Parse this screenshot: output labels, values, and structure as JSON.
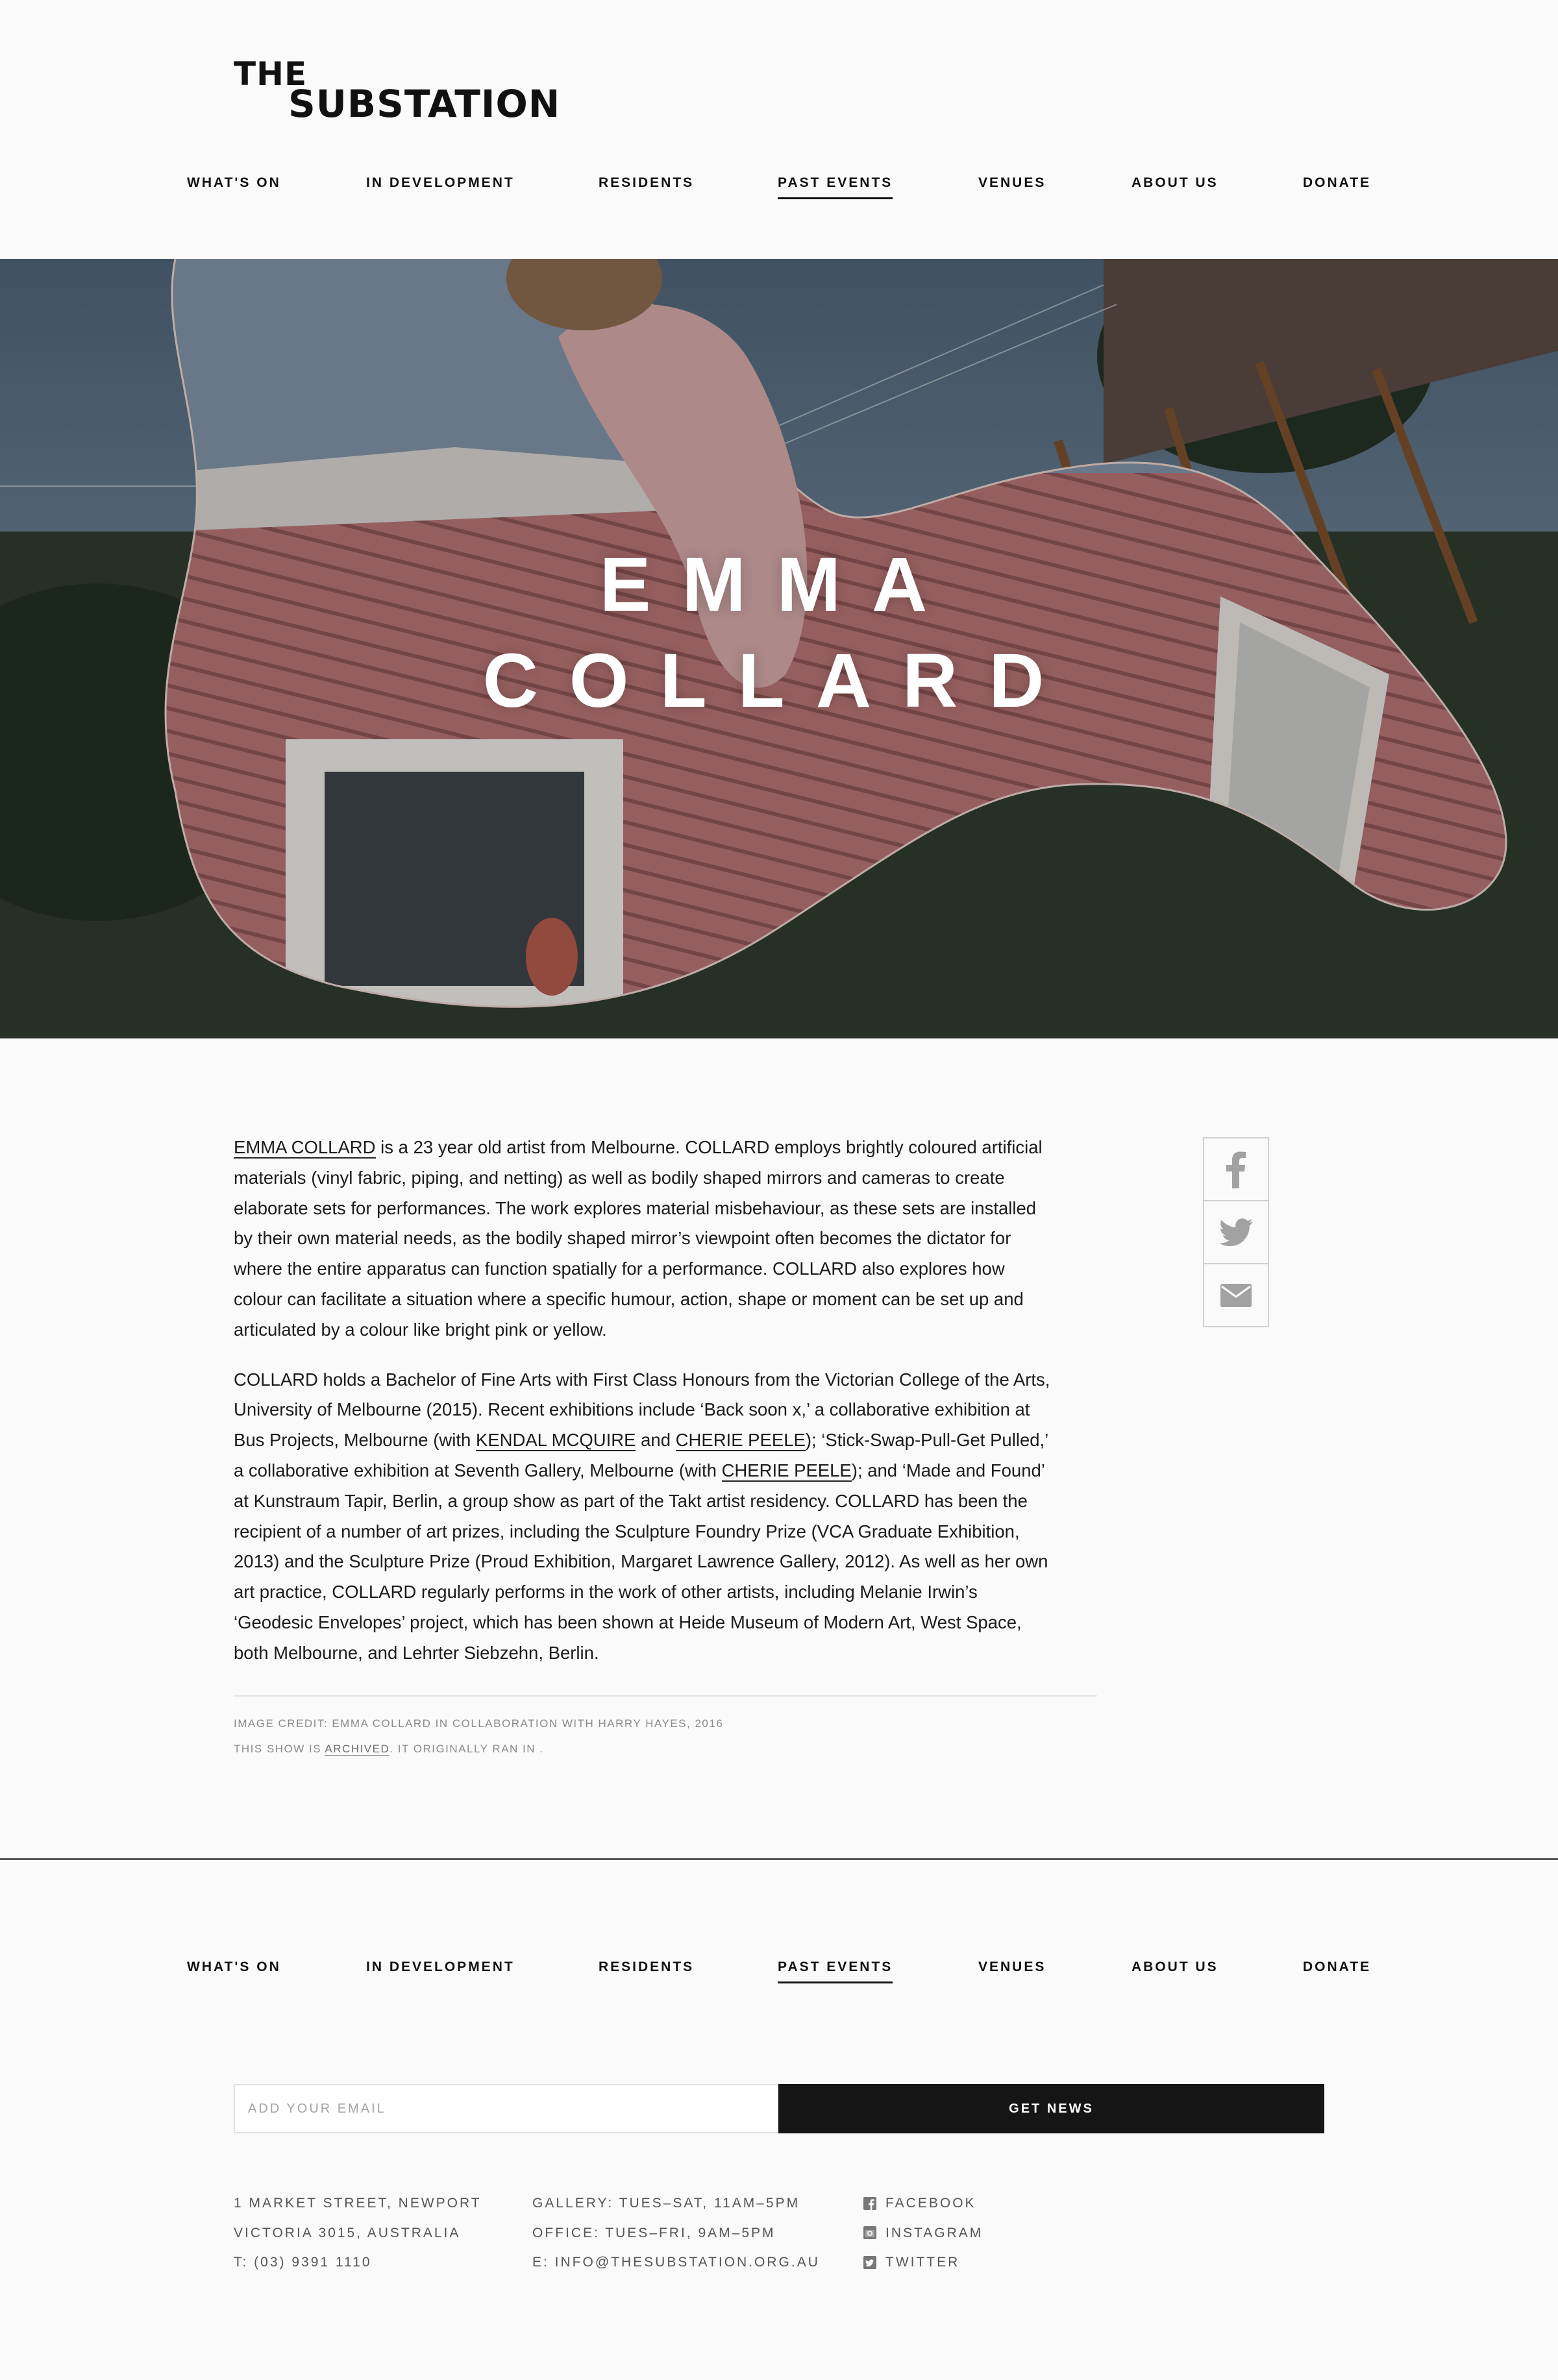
{
  "brand": {
    "line1": "THE",
    "line2": "SUBSTATION"
  },
  "nav": {
    "items": [
      "WHAT'S ON",
      "IN DEVELOPMENT",
      "RESIDENTS",
      "PAST EVENTS",
      "VENUES",
      "ABOUT US",
      "DONATE"
    ],
    "active": "PAST EVENTS"
  },
  "hero": {
    "line1": "EMMA",
    "line2": "COLLARD",
    "image": "photo of a person holding a large organic-shaped mirror in a garden, reflecting a pink weatherboard house"
  },
  "article": {
    "p1": {
      "link": "EMMA COLLARD",
      "text": " is a 23 year old artist from Melbourne. COLLARD employs brightly coloured artificial materials (vinyl fabric, piping, and netting) as well as bodily shaped mirrors and cameras to create elaborate sets for performances. The work explores material misbehaviour, as these sets are installed by their own material needs, as the bodily shaped mirror’s viewpoint often becomes the dictator for where the entire apparatus can function spatially for a performance. COLLARD also explores how colour can facilitate a situation where a specific humour, action, shape or moment can be set up and articulated by a colour like bright pink or yellow."
    },
    "p2": {
      "t1": "COLLARD holds a Bachelor of Fine Arts with First Class Honours from the Victorian College of the Arts, University of Melbourne (2015). Recent exhibitions include ‘Back soon x,’ a collaborative exhibition at Bus Projects, Melbourne (with ",
      "link1": "KENDAL MCQUIRE",
      "t2": " and ",
      "link2": "CHERIE PEELE",
      "t3": "); ‘Stick-Swap-Pull-Get Pulled,’ a collaborative exhibition at Seventh Gallery, Melbourne (with ",
      "link3": "CHERIE PEELE",
      "t4": "); and ‘Made and Found’ at Kunstraum Tapir, Berlin, a group show as part of the Takt artist residency. COLLARD has been the recipient of a number of art prizes, including the Sculpture Foundry Prize (VCA Graduate Exhibition, 2013) and the Sculpture Prize (Proud Exhibition, Margaret Lawrence Gallery, 2012). As well as her own art practice, COLLARD regularly performs in the work of other artists, including Melanie Irwin’s ‘Geodesic Envelopes’ project, which has been shown at Heide Museum of Modern Art, West Space, both Melbourne, and Lehrter Siebzehn, Berlin."
    }
  },
  "meta": {
    "credit": "IMAGE CREDIT: EMMA COLLARD IN COLLABORATION WITH HARRY HAYES, 2016",
    "archived_prefix": "THIS SHOW IS ",
    "archived_link": "ARCHIVED",
    "archived_suffix": ". IT ORIGINALLY RAN IN ."
  },
  "share": [
    "facebook-icon",
    "twitter-icon",
    "email-icon"
  ],
  "newsletter": {
    "placeholder": "ADD YOUR EMAIL",
    "button": "GET NEWS"
  },
  "footer": {
    "address": [
      "1 MARKET STREET, NEWPORT",
      "VICTORIA 3015, AUSTRALIA",
      "T: (03) 9391 1110"
    ],
    "hours": [
      "GALLERY: TUES–SAT, 11AM–5PM",
      "OFFICE: TUES–FRI, 9AM–5PM",
      "E: INFO@THESUBSTATION.ORG.AU"
    ],
    "social": [
      "FACEBOOK",
      "INSTAGRAM",
      "TWITTER"
    ]
  },
  "colors": {
    "text": "#151515",
    "background": "#fafafa",
    "button": "#151515",
    "muted": "#8a8a8a"
  }
}
